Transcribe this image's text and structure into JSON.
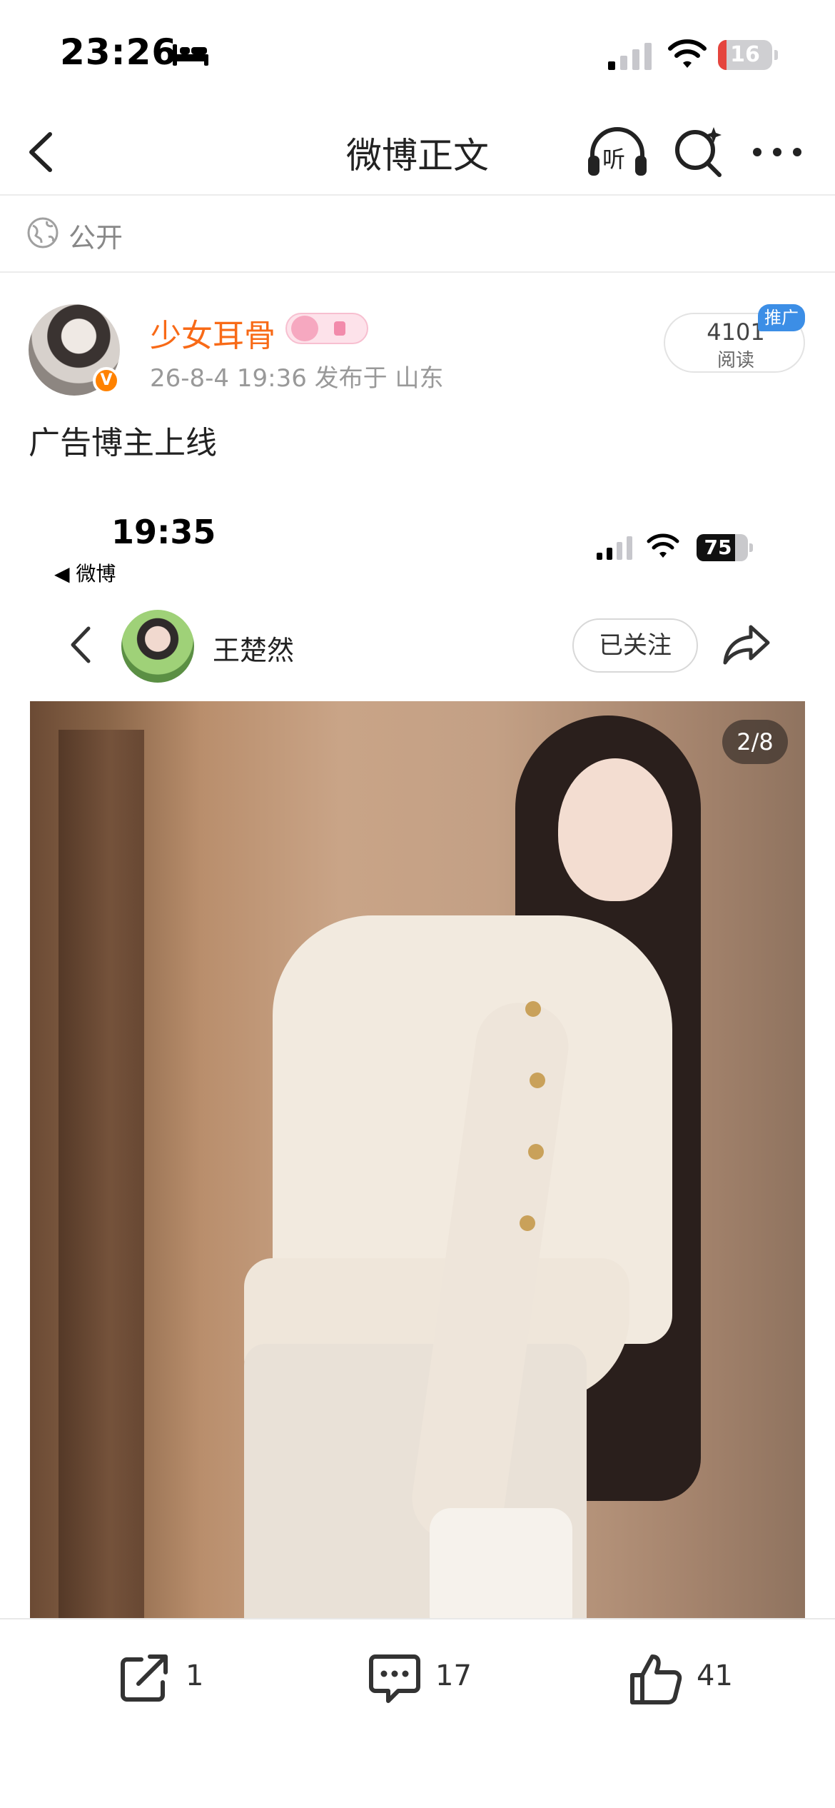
{
  "status_bar": {
    "time": "23:26",
    "battery": "16",
    "battery_level": 0.16,
    "sleep_icon": "bed-icon",
    "signal_icon": "cellular-signal-icon",
    "wifi_icon": "wifi-icon"
  },
  "nav": {
    "title": "微博正文",
    "back_icon": "chevron-left-icon",
    "listen_label": "听",
    "search_icon": "search-sparkle-icon",
    "more_icon": "more-dots-icon"
  },
  "visibility": {
    "label": "公开",
    "icon": "globe-icon"
  },
  "post": {
    "username": "少女耳骨",
    "username_color": "#f86a17",
    "meta": "26-8-4 19:36  发布于 山东",
    "verified_badge": "V",
    "read_count": "4101",
    "read_label": "阅读",
    "promo_tag": "推广",
    "text": "广告博主上线"
  },
  "embedded": {
    "time": "19:35",
    "back_app": "◀ 微博",
    "battery": "75",
    "battery_level": 0.75,
    "author_name": "王楚然",
    "follow_label": "已关注",
    "photo_counter": "2/8"
  },
  "toolbar": {
    "repost_count": "1",
    "comment_count": "17",
    "like_count": "41"
  },
  "colors": {
    "accent": "#ff8200",
    "username": "#f86a17",
    "promo": "#3c8ee6",
    "battery_low": "#e5453e"
  }
}
